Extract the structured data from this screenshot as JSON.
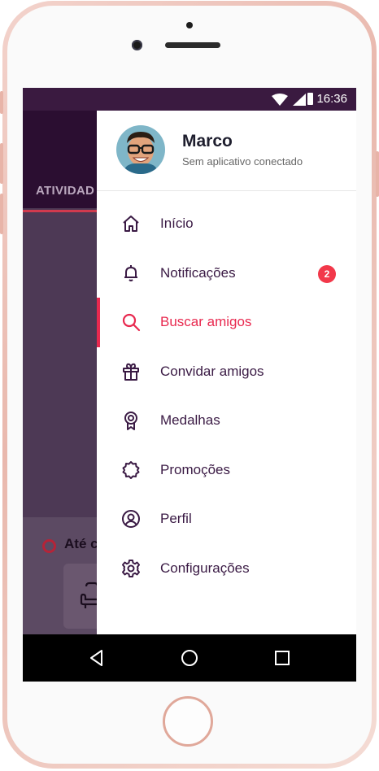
{
  "status_bar": {
    "time": "16:36",
    "icons": [
      "wifi-icon",
      "signal-icon",
      "battery-icon"
    ]
  },
  "background_app": {
    "tab_label": "ATIVIDAD",
    "card_text": "Até c",
    "card_icon": "armchair-icon"
  },
  "drawer": {
    "user": {
      "name": "Marco",
      "status": "Sem aplicativo conectado",
      "avatar_icon": "user-avatar"
    },
    "menu": [
      {
        "label": "Início",
        "icon": "home-icon",
        "active": false
      },
      {
        "label": "Notificações",
        "icon": "bell-icon",
        "active": false,
        "badge": "2"
      },
      {
        "label": "Buscar amigos",
        "icon": "search-icon",
        "active": true
      },
      {
        "label": "Convidar amigos",
        "icon": "gift-icon",
        "active": false
      },
      {
        "label": "Medalhas",
        "icon": "medal-icon",
        "active": false
      },
      {
        "label": "Promoções",
        "icon": "promo-badge-icon",
        "active": false
      },
      {
        "label": "Perfil",
        "icon": "profile-icon",
        "active": false
      },
      {
        "label": "Configurações",
        "icon": "gear-icon",
        "active": false
      }
    ]
  },
  "nav_bar": {
    "buttons": [
      "back-icon",
      "home-circle-icon",
      "recents-icon"
    ]
  },
  "colors": {
    "status_bar": "#3a1a40",
    "accent": "#e8294f",
    "menu_text": "#3a1a44",
    "badge": "#f2384a",
    "overlay": "#4d3955"
  }
}
